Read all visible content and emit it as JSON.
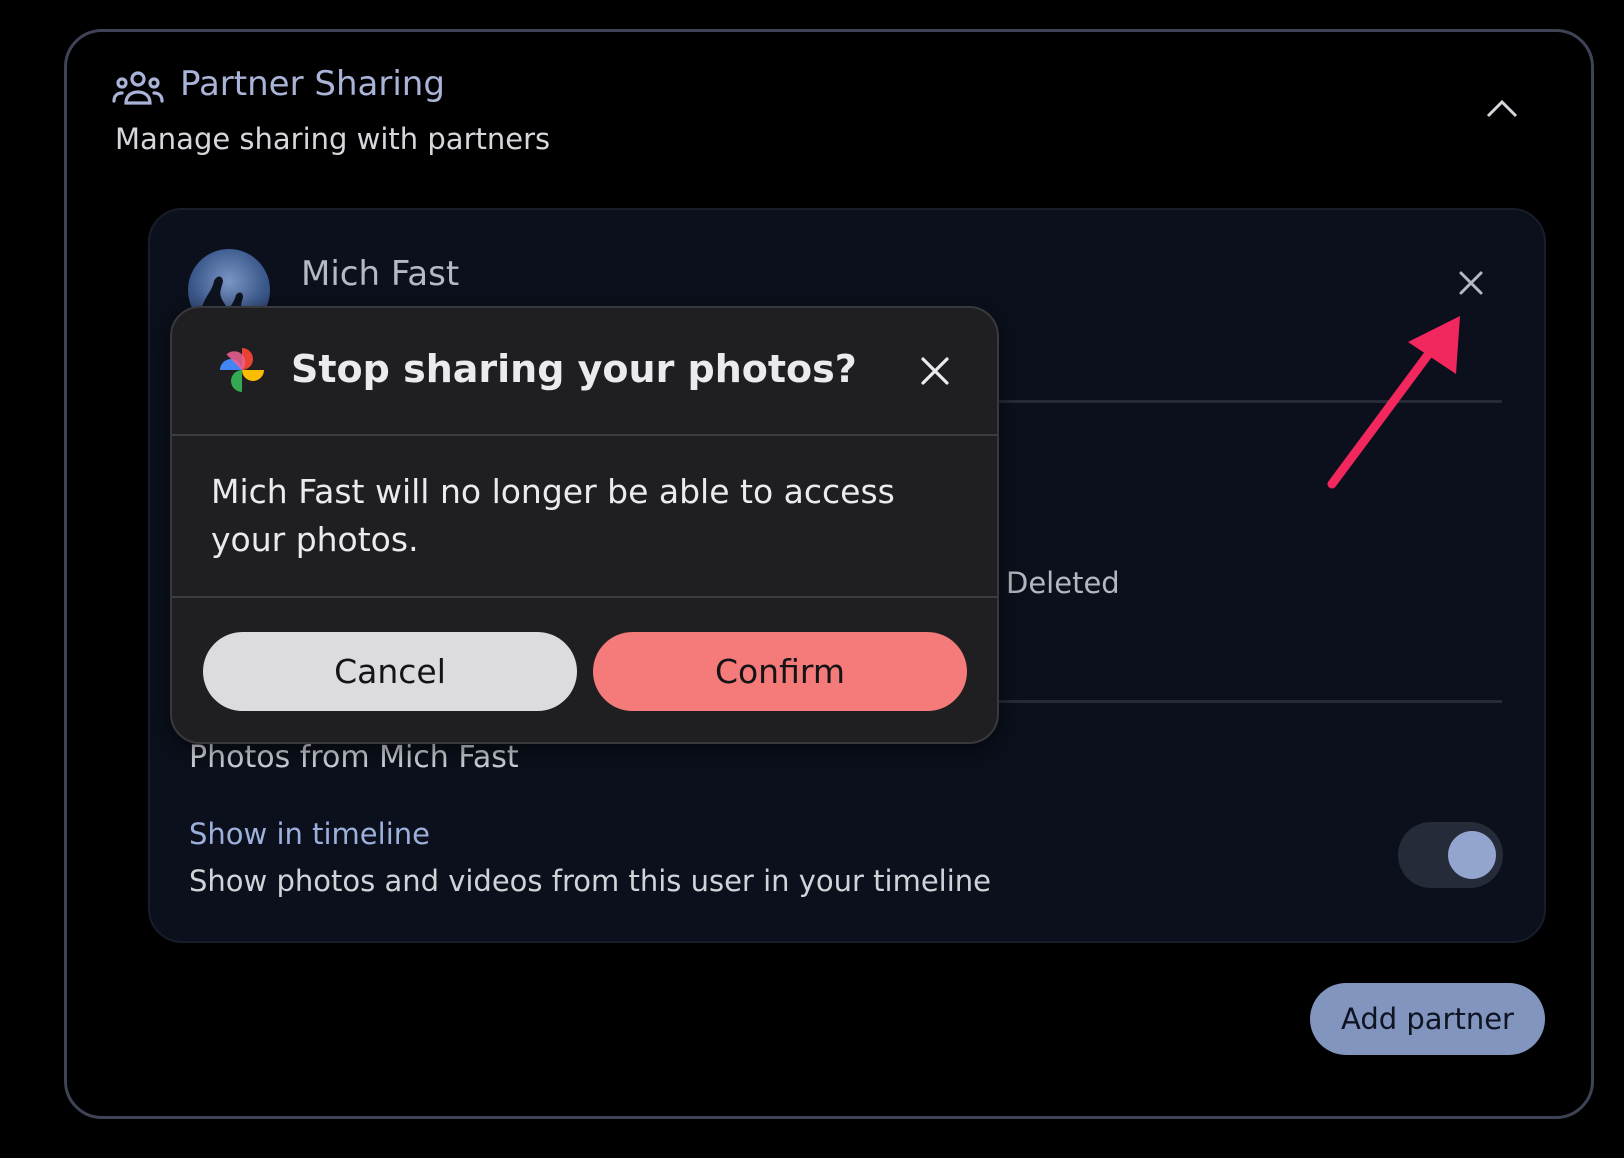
{
  "header": {
    "icon": "people-icon",
    "title": "Partner Sharing",
    "subtitle": "Manage sharing with partners"
  },
  "partner": {
    "name": "Mich Fast",
    "background_label": "Deleted",
    "photos_from_heading": "Photos from Mich Fast",
    "timeline_title": "Show in timeline",
    "timeline_description": "Show photos and videos from this user in your timeline",
    "timeline_enabled": true
  },
  "add_partner_label": "Add partner",
  "dialog": {
    "title": "Stop sharing your photos?",
    "message": "Mich Fast will no longer be able to access your photos.",
    "cancel_label": "Cancel",
    "confirm_label": "Confirm"
  },
  "colors": {
    "accent": "#a9b4d8",
    "confirm": "#f47b79",
    "annotation_arrow": "#f2275d"
  }
}
